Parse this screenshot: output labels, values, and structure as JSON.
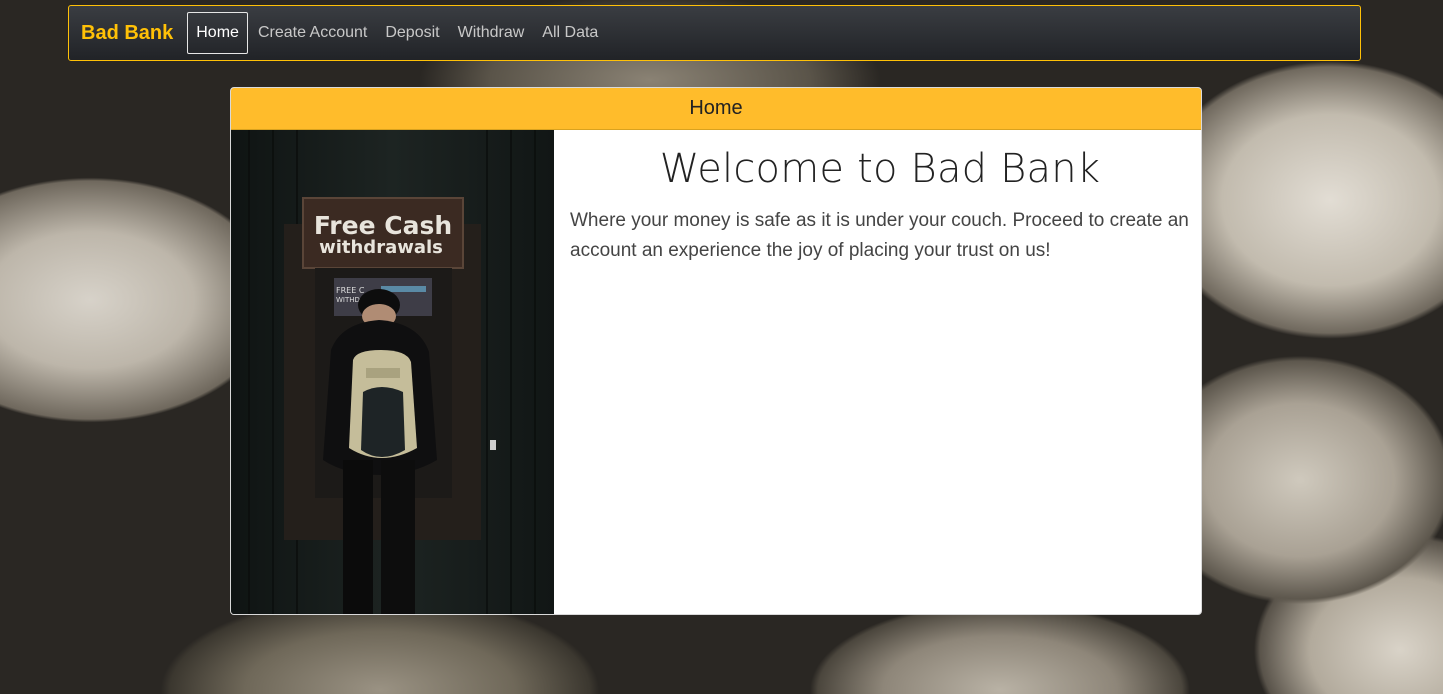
{
  "nav": {
    "brand": "Bad Bank",
    "items": [
      {
        "label": "Home",
        "active": true
      },
      {
        "label": "Create Account",
        "active": false
      },
      {
        "label": "Deposit",
        "active": false
      },
      {
        "label": "Withdraw",
        "active": false
      },
      {
        "label": "All Data",
        "active": false
      }
    ]
  },
  "card": {
    "header": "Home",
    "title": "Welcome to Bad Bank",
    "text": "Where your money is safe as it is under your couch. Proceed to create an account an experience the joy of placing your trust on us!",
    "image": {
      "sign_line1": "Free Cash",
      "sign_line2": "withdrawals",
      "screen_text": "FREE C",
      "screen_text2": "WITHD"
    }
  },
  "colors": {
    "accent": "#ffc107",
    "header_bg": "#ffbc2b",
    "navbar_bg": "#2b2d31"
  }
}
